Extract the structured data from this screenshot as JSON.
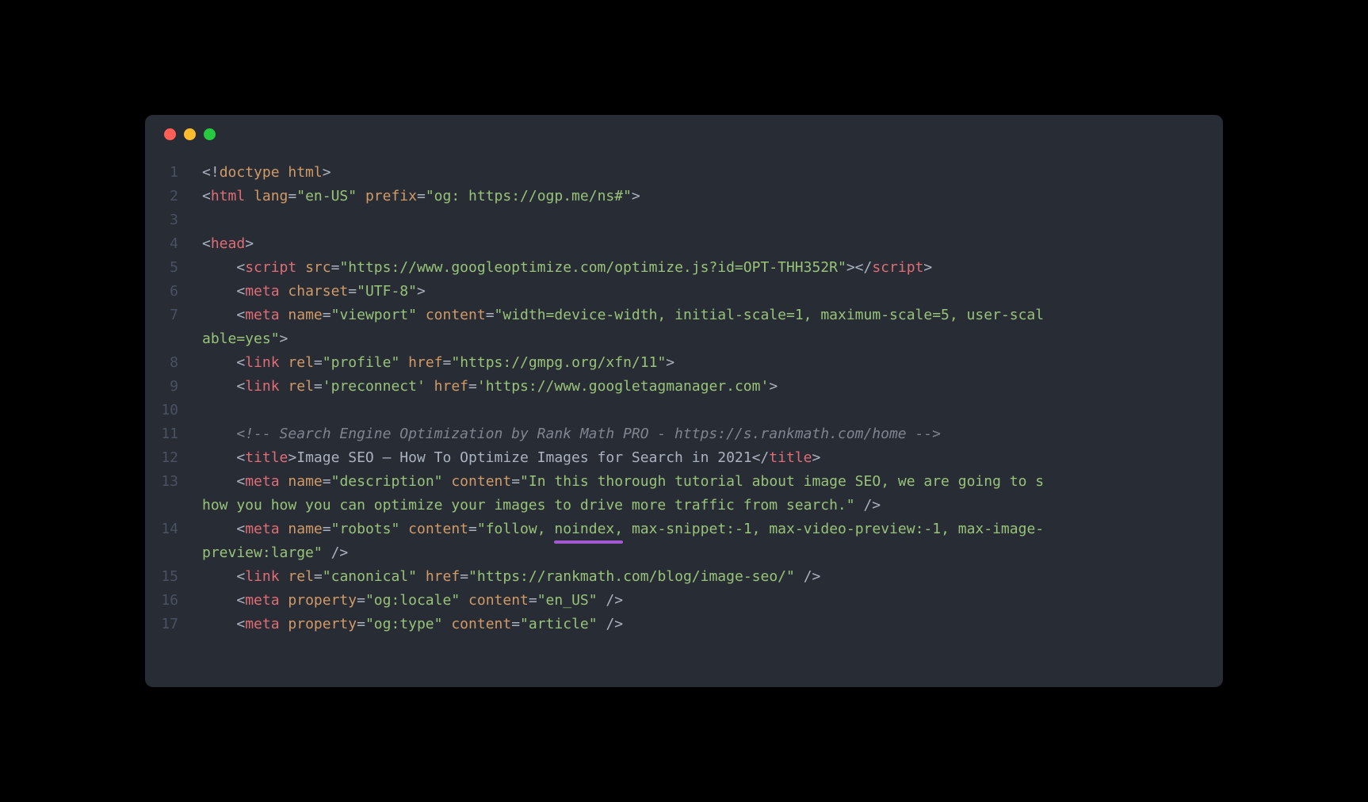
{
  "window": {
    "traffic_lights": [
      "red",
      "yellow",
      "green"
    ]
  },
  "code": {
    "lines": [
      {
        "n": "1",
        "html": "<span class='c-punct'>&lt;!</span><span class='c-doctype-kw'>doctype html</span><span class='c-punct'>&gt;</span>"
      },
      {
        "n": "2",
        "html": "<span class='c-punct'>&lt;</span><span class='c-tag'>html</span> <span class='c-attr'>lang</span><span class='c-op'>=</span><span class='c-string'>\"en-US\"</span> <span class='c-attr'>prefix</span><span class='c-op'>=</span><span class='c-string'>\"og: https://ogp.me/ns#\"</span><span class='c-punct'>&gt;</span>"
      },
      {
        "n": "3",
        "html": ""
      },
      {
        "n": "4",
        "html": "<span class='c-punct'>&lt;</span><span class='c-tag'>head</span><span class='c-punct'>&gt;</span>"
      },
      {
        "n": "5",
        "html": "    <span class='c-punct'>&lt;</span><span class='c-tag'>script</span> <span class='c-attr'>src</span><span class='c-op'>=</span><span class='c-string'>\"https://www.googleoptimize.com/optimize.js?id=OPT-THH352R\"</span><span class='c-punct'>&gt;&lt;/</span><span class='c-tag'>script</span><span class='c-punct'>&gt;</span>"
      },
      {
        "n": "6",
        "html": "    <span class='c-punct'>&lt;</span><span class='c-tag'>meta</span> <span class='c-attr'>charset</span><span class='c-op'>=</span><span class='c-string'>\"UTF-8\"</span><span class='c-punct'>&gt;</span>"
      },
      {
        "n": "7",
        "html": "    <span class='c-punct'>&lt;</span><span class='c-tag'>meta</span> <span class='c-attr'>name</span><span class='c-op'>=</span><span class='c-string'>\"viewport\"</span> <span class='c-attr'>content</span><span class='c-op'>=</span><span class='c-string'>\"width=device-width, initial-scale=1, maximum-scale=5, user-scal</span>",
        "wrap": "<span class='c-string'>able=yes\"</span><span class='c-punct'>&gt;</span>"
      },
      {
        "n": "8",
        "html": "    <span class='c-punct'>&lt;</span><span class='c-tag'>link</span> <span class='c-attr'>rel</span><span class='c-op'>=</span><span class='c-string'>\"profile\"</span> <span class='c-attr'>href</span><span class='c-op'>=</span><span class='c-string'>\"https://gmpg.org/xfn/11\"</span><span class='c-punct'>&gt;</span>"
      },
      {
        "n": "9",
        "html": "    <span class='c-punct'>&lt;</span><span class='c-tag'>link</span> <span class='c-attr'>rel</span><span class='c-op'>=</span><span class='c-string'>'preconnect'</span> <span class='c-attr'>href</span><span class='c-op'>=</span><span class='c-string'>'https://www.googletagmanager.com'</span><span class='c-punct'>&gt;</span>"
      },
      {
        "n": "10",
        "html": ""
      },
      {
        "n": "11",
        "html": "    <span class='c-comment'>&lt;!-- Search Engine Optimization by Rank Math PRO - https://s.rankmath.com/home --&gt;</span>"
      },
      {
        "n": "12",
        "html": "    <span class='c-punct'>&lt;</span><span class='c-tag'>title</span><span class='c-punct'>&gt;</span>Image SEO – How To Optimize Images for Search in 2021<span class='c-punct'>&lt;/</span><span class='c-tag'>title</span><span class='c-punct'>&gt;</span>"
      },
      {
        "n": "13",
        "html": "    <span class='c-punct'>&lt;</span><span class='c-tag'>meta</span> <span class='c-attr'>name</span><span class='c-op'>=</span><span class='c-string'>\"description\"</span> <span class='c-attr'>content</span><span class='c-op'>=</span><span class='c-string'>\"In this thorough tutorial about image SEO, we are going to s</span>",
        "wrap": "<span class='c-string'>how you how you can optimize your images to drive more traffic from search.\"</span> <span class='c-punct'>/&gt;</span>"
      },
      {
        "n": "14",
        "html": "    <span class='c-punct'>&lt;</span><span class='c-tag'>meta</span> <span class='c-attr'>name</span><span class='c-op'>=</span><span class='c-string'>\"robots\"</span> <span class='c-attr'>content</span><span class='c-op'>=</span><span class='c-string'>\"follow, <span class='underline-highlight'>noindex,</span> max-snippet:-1, max-video-preview:-1, max-image-</span>",
        "wrap": "<span class='c-string'>preview:large\"</span> <span class='c-punct'>/&gt;</span>"
      },
      {
        "n": "15",
        "html": "    <span class='c-punct'>&lt;</span><span class='c-tag'>link</span> <span class='c-attr'>rel</span><span class='c-op'>=</span><span class='c-string'>\"canonical\"</span> <span class='c-attr'>href</span><span class='c-op'>=</span><span class='c-string'>\"https://rankmath.com/blog/image-seo/\"</span> <span class='c-punct'>/&gt;</span>"
      },
      {
        "n": "16",
        "html": "    <span class='c-punct'>&lt;</span><span class='c-tag'>meta</span> <span class='c-attr'>property</span><span class='c-op'>=</span><span class='c-string'>\"og:locale\"</span> <span class='c-attr'>content</span><span class='c-op'>=</span><span class='c-string'>\"en_US\"</span> <span class='c-punct'>/&gt;</span>"
      },
      {
        "n": "17",
        "html": "    <span class='c-punct'>&lt;</span><span class='c-tag'>meta</span> <span class='c-attr'>property</span><span class='c-op'>=</span><span class='c-string'>\"og:type\"</span> <span class='c-attr'>content</span><span class='c-op'>=</span><span class='c-string'>\"article\"</span> <span class='c-punct'>/&gt;</span>"
      }
    ]
  },
  "highlight": {
    "text": "noindex,",
    "color": "#a459d1"
  }
}
